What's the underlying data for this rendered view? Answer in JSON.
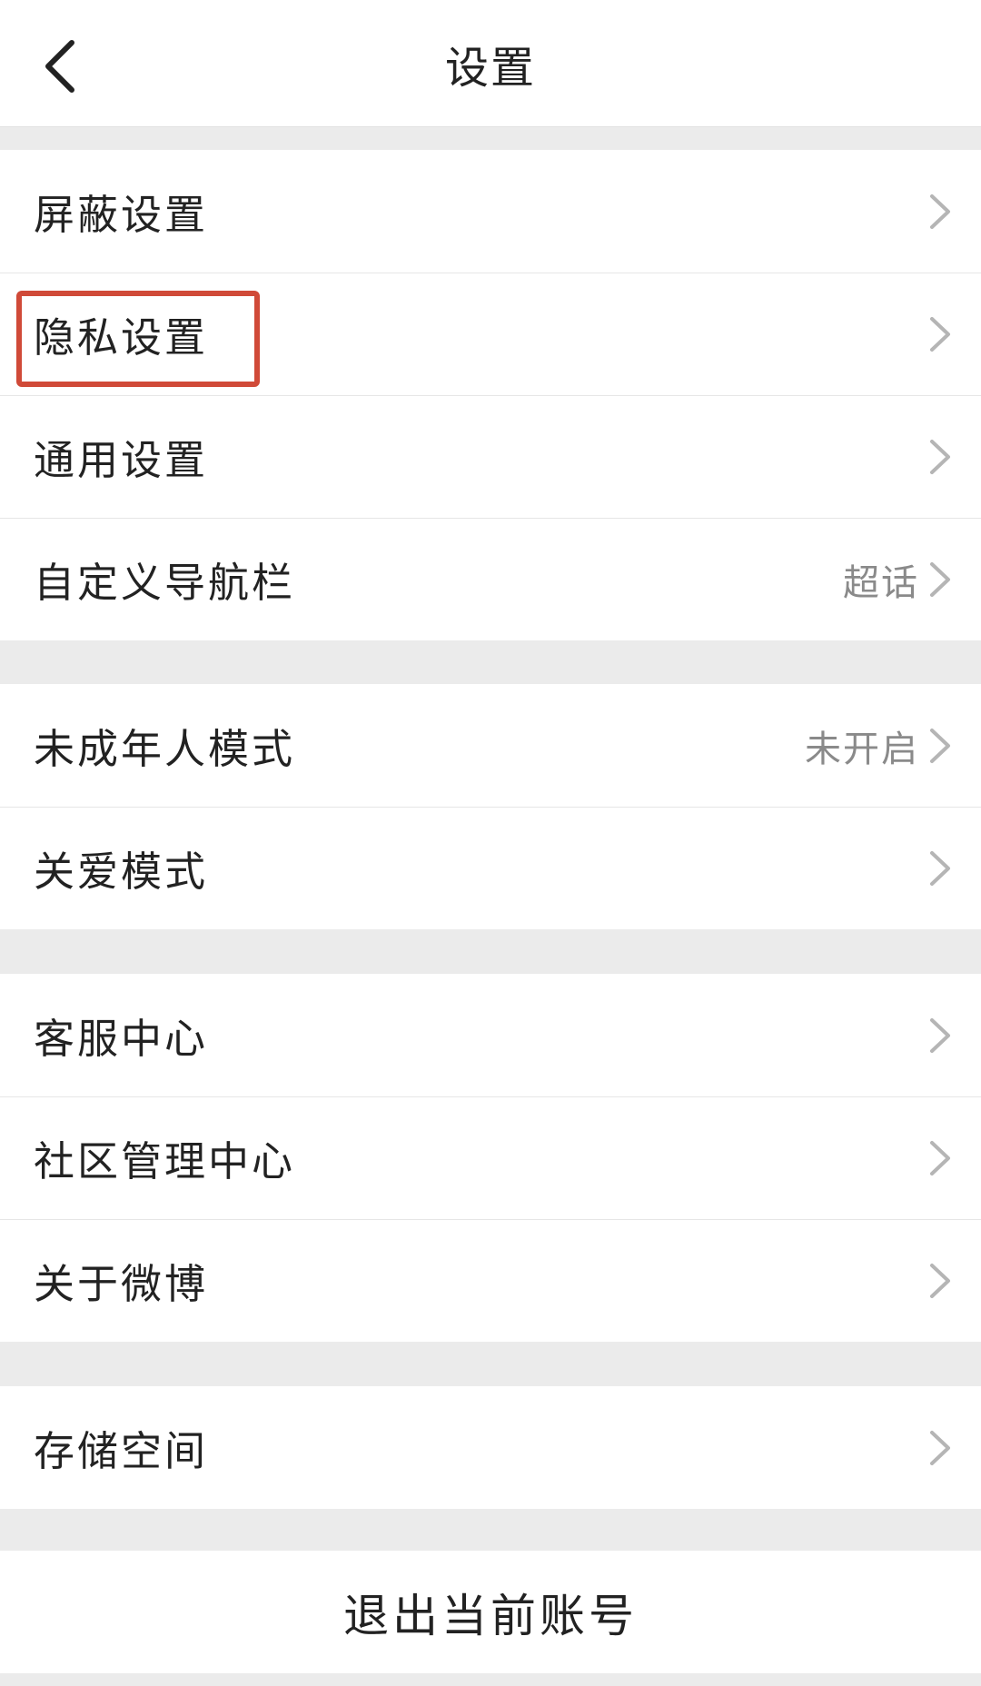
{
  "header": {
    "title": "设置",
    "back_icon": "chevron-left-icon"
  },
  "groups": [
    {
      "items": [
        {
          "label": "屏蔽设置",
          "value": ""
        },
        {
          "label": "隐私设置",
          "value": "",
          "highlighted": true
        },
        {
          "label": "通用设置",
          "value": ""
        },
        {
          "label": "自定义导航栏",
          "value": "超话"
        }
      ]
    },
    {
      "items": [
        {
          "label": "未成年人模式",
          "value": "未开启"
        },
        {
          "label": "关爱模式",
          "value": ""
        }
      ]
    },
    {
      "items": [
        {
          "label": "客服中心",
          "value": ""
        },
        {
          "label": "社区管理中心",
          "value": ""
        },
        {
          "label": "关于微博",
          "value": ""
        }
      ]
    },
    {
      "items": [
        {
          "label": "存储空间",
          "value": ""
        }
      ]
    }
  ],
  "logout": {
    "label": "退出当前账号"
  },
  "colors": {
    "background": "#ebebeb",
    "surface": "#ffffff",
    "text": "#222222",
    "secondary_text": "#8a8a8a",
    "chevron": "#b5b5b5",
    "highlight": "#d04a38"
  }
}
